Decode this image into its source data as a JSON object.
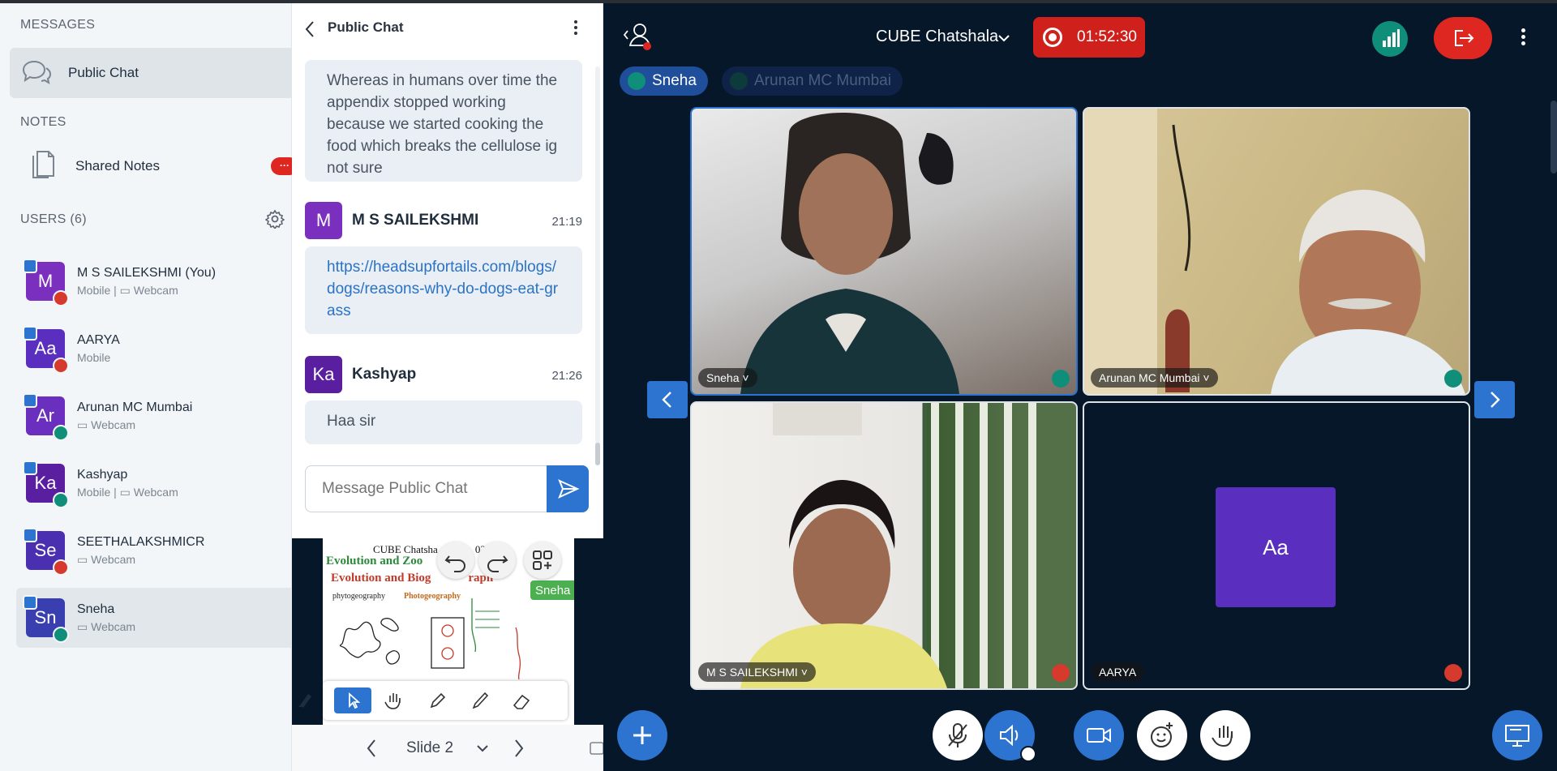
{
  "nav": {
    "messages_title": "MESSAGES",
    "public_chat_label": "Public Chat",
    "notes_title": "NOTES",
    "shared_notes_label": "Shared Notes",
    "shared_notes_badge": "···",
    "users_title": "USERS (6)",
    "users": [
      {
        "initials": "M",
        "name": "M S SAILEKSHMI (You)",
        "sub": "Mobile | ▭ Webcam",
        "color": "#7b2fbf"
      },
      {
        "initials": "Aa",
        "name": "AARYA",
        "sub": "Mobile",
        "color": "#5a2fbf"
      },
      {
        "initials": "Ar",
        "name": "Arunan MC Mumbai",
        "sub": "▭ Webcam",
        "color": "#6a2fbf"
      },
      {
        "initials": "Ka",
        "name": "Kashyap",
        "sub": "Mobile | ▭ Webcam",
        "color": "#5a1fa0"
      },
      {
        "initials": "Se",
        "name": "SEETHALAKSHMICR",
        "sub": "▭ Webcam",
        "color": "#4a2fb0"
      },
      {
        "initials": "Sn",
        "name": "Sneha",
        "sub": "▭ Webcam",
        "color": "#3a3fb0"
      }
    ]
  },
  "chat": {
    "title": "Public Chat",
    "messages": [
      {
        "text": "Whereas in humans over time the appendix stopped working because we started cooking the food which breaks the cellulose ig not sure"
      },
      {
        "initials": "M",
        "name": "M S SAILEKSHMI",
        "time": "21:19",
        "text": "https://headsupfortails.com/blogs/dogs/reasons-why-do-dogs-eat-grass"
      },
      {
        "initials": "Ka",
        "name": "Kashyap",
        "time": "21:26",
        "text": "Haa sir"
      }
    ],
    "input_placeholder": "Message Public Chat"
  },
  "presentation": {
    "slide_title": "CUBE Chatsha",
    "slide_date": "02",
    "heading1": "Evolution and Zoo",
    "heading2": "Evolution and Biog",
    "heading2_suffix": "raph",
    "phyto": "phytogeography",
    "photo": "Photogeography",
    "presenter_tag": "Sneha",
    "slide_label": "Slide 2"
  },
  "meeting": {
    "name": "CUBE Chatshala",
    "rec_time": "01:52:30",
    "talkers": [
      "Sneha",
      "Arunan MC Mumbai"
    ],
    "tiles": [
      "Sneha",
      "Arunan MC Mumbai",
      "M S SAILEKSHMI",
      "AARYA"
    ],
    "aarya_initials": "Aa"
  },
  "colors": {
    "accent": "#2c74d0",
    "danger": "#df2721",
    "teal": "#0f8f7a",
    "background": "#06172a"
  }
}
